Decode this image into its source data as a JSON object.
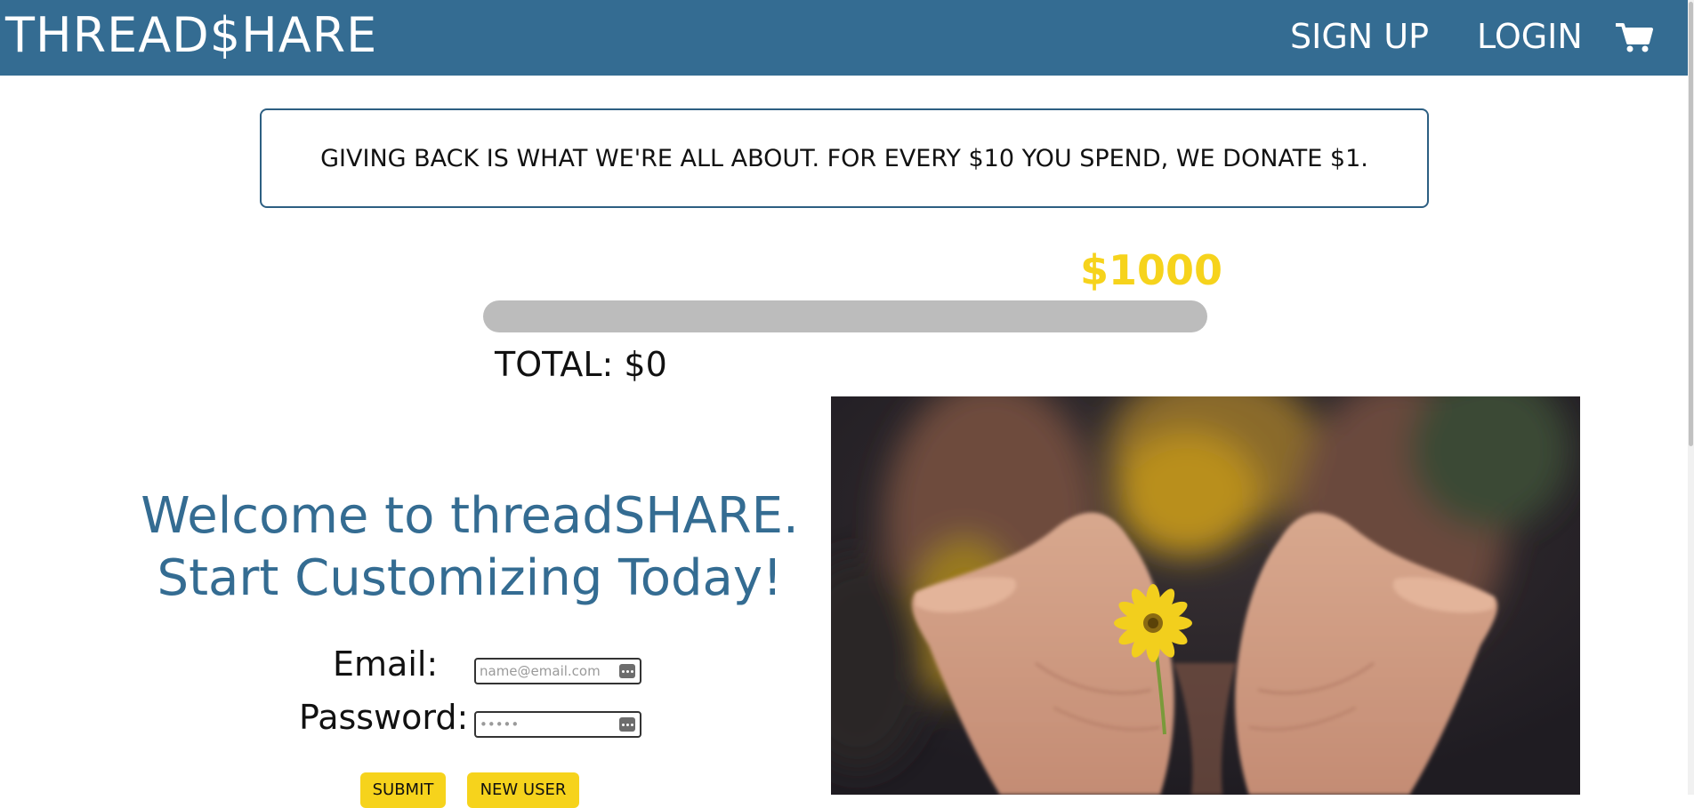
{
  "header": {
    "brand": "THREAD$HARE",
    "nav": {
      "signup": "SIGN UP",
      "login": "LOGIN"
    },
    "cart_icon": "shopping-cart-icon",
    "background_color": "#346c92"
  },
  "banner": {
    "text": "GIVING BACK IS WHAT WE'RE ALL ABOUT. FOR EVERY $10 YOU SPEND, WE DONATE $1."
  },
  "donation": {
    "goal_label": "$1000",
    "total_label": "TOTAL: $0",
    "progress_fraction": 0,
    "accent_color": "#f6d31c",
    "track_color": "#bcbcbc"
  },
  "welcome": {
    "line1": "Welcome to threadSHARE.",
    "line2": "Start Customizing Today!",
    "color": "#346c92"
  },
  "login_form": {
    "email_label": "Email:",
    "email_placeholder": "name@email.com",
    "password_label": "Password:",
    "password_placeholder": "•••••",
    "submit_label": "SUBMIT",
    "new_user_label": "NEW USER",
    "field_icon": "password-manager-key-icon"
  },
  "hero": {
    "image": "open-hands-holding-yellow-flower-photo"
  }
}
